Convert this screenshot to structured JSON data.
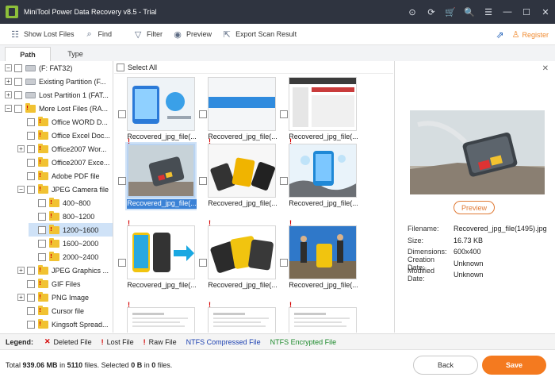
{
  "window": {
    "title": "MiniTool Power Data Recovery v8.5 - Trial",
    "controls": [
      "⊙",
      "⟳",
      "🛒",
      "🔍",
      "☰",
      "—",
      "☐",
      "✕"
    ]
  },
  "toolbar": {
    "show_lost_files": "Show Lost Files",
    "find": "Find",
    "filter": "Filter",
    "preview": "Preview",
    "export_scan_result": "Export Scan Result",
    "register": "Register"
  },
  "tabs": [
    "Path",
    "Type"
  ],
  "tree": [
    {
      "label": "(F: FAT32)",
      "toggle": "−",
      "icon": "drive"
    },
    {
      "label": "Existing Partition (F...",
      "toggle": "+",
      "icon": "drive"
    },
    {
      "label": "Lost Partition 1 (FAT...",
      "toggle": "+",
      "icon": "drive"
    },
    {
      "label": "More Lost Files (RA...",
      "toggle": "−",
      "icon": "folder-exclaim"
    },
    {
      "label": "Office WORD D...",
      "toggle": "",
      "icon": "folder-exclaim"
    },
    {
      "label": "Office Excel Doc...",
      "toggle": "",
      "icon": "folder-exclaim"
    },
    {
      "label": "Office2007 Wor...",
      "toggle": "+",
      "icon": "folder-exclaim"
    },
    {
      "label": "Office2007 Exce...",
      "toggle": "",
      "icon": "folder-exclaim"
    },
    {
      "label": "Adobe PDF file",
      "toggle": "",
      "icon": "folder-exclaim"
    },
    {
      "label": "JPEG Camera file",
      "toggle": "−",
      "icon": "folder-exclaim"
    },
    {
      "label": "400~800",
      "toggle": "",
      "icon": "folder-exclaim"
    },
    {
      "label": "800~1200",
      "toggle": "",
      "icon": "folder-exclaim"
    },
    {
      "label": "1200~1600",
      "toggle": "",
      "icon": "folder-exclaim"
    },
    {
      "label": "1600~2000",
      "toggle": "",
      "icon": "folder-exclaim"
    },
    {
      "label": "2000~2400",
      "toggle": "",
      "icon": "folder-exclaim"
    },
    {
      "label": "JPEG Graphics ...",
      "toggle": "+",
      "icon": "folder-exclaim"
    },
    {
      "label": "GIF Files",
      "toggle": "",
      "icon": "folder-exclaim"
    },
    {
      "label": "PNG Image",
      "toggle": "+",
      "icon": "folder-exclaim"
    },
    {
      "label": "Cursor file",
      "toggle": "",
      "icon": "folder-exclaim"
    },
    {
      "label": "Kingsoft Spread...",
      "toggle": "",
      "icon": "folder-exclaim"
    }
  ],
  "grid": {
    "select_all": "Select All",
    "items": [
      {
        "caption": "Recovered_jpg_file(...",
        "thumb": "phone-screen",
        "lost": false
      },
      {
        "caption": "Recovered_jpg_file(...",
        "thumb": "blue-banner",
        "lost": false
      },
      {
        "caption": "Recovered_jpg_file(...",
        "thumb": "screenshot",
        "lost": false
      },
      {
        "caption": "Recovered_jpg_file(...",
        "thumb": "card-reader",
        "lost": true
      },
      {
        "caption": "Recovered_jpg_file(...",
        "thumb": "rugged-phones",
        "lost": true
      },
      {
        "caption": "Recovered_jpg_file(...",
        "thumb": "rugged-splash",
        "lost": true
      },
      {
        "caption": "Recovered_jpg_file(...",
        "thumb": "phone-case",
        "lost": true
      },
      {
        "caption": "Recovered_jpg_file(...",
        "thumb": "phones-yellow",
        "lost": true
      },
      {
        "caption": "Recovered_jpg_file(...",
        "thumb": "hikers",
        "lost": true
      },
      {
        "caption": "",
        "thumb": "document",
        "lost": true
      },
      {
        "caption": "",
        "thumb": "document",
        "lost": true
      },
      {
        "caption": "",
        "thumb": "document",
        "lost": true
      }
    ]
  },
  "preview": {
    "button": "Preview",
    "meta": [
      {
        "key": "Filename:",
        "value": "Recovered_jpg_file(1495).jpg"
      },
      {
        "key": "Size:",
        "value": "16.73 KB"
      },
      {
        "key": "Dimensions:",
        "value": "600x400"
      },
      {
        "key": "Creation Date:",
        "value": "Unknown"
      },
      {
        "key": "Modified Date:",
        "value": "Unknown"
      }
    ]
  },
  "legend": {
    "title": "Legend:",
    "deleted": "Deleted File",
    "lost": "Lost File",
    "raw": "Raw File",
    "ntfs_compressed": "NTFS Compressed File",
    "ntfs_encrypted": "NTFS Encrypted File"
  },
  "status": {
    "total_prefix": "Total",
    "total_size": "939.06 MB",
    "in": "in",
    "file_count": "5110",
    "files_selected": "files.  Selected",
    "selected_size": "0 B",
    "in2": "in",
    "selected_count": "0",
    "files_end": "files."
  },
  "buttons": {
    "back": "Back",
    "save": "Save"
  },
  "colors": {
    "titlebar": "#2f3440",
    "accent": "#f47a1f",
    "selection": "#3b82d6",
    "lost_marker": "#d40000"
  }
}
